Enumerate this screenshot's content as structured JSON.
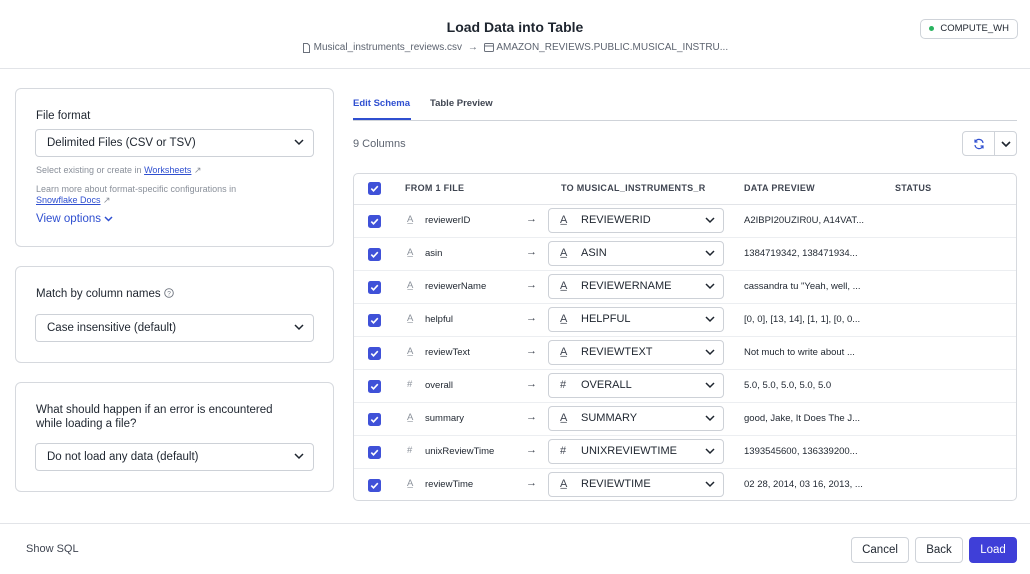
{
  "header": {
    "title": "Load Data into Table",
    "source_file": "Musical_instruments_reviews.csv",
    "target_table": "AMAZON_REVIEWS.PUBLIC.MUSICAL_INSTRU...",
    "warehouse": "COMPUTE_WH",
    "warehouse_status_color": "#29b35f"
  },
  "file_format": {
    "label": "File format",
    "value": "Delimited Files (CSV or TSV)",
    "hint_prefix": "Select existing or create in",
    "hint_link": "Worksheets",
    "learn_more": "Learn more about format-specific configurations in",
    "docs_link": "Snowflake Docs",
    "view_options": "View options"
  },
  "match": {
    "label": "Match by column names",
    "value": "Case insensitive (default)"
  },
  "error": {
    "label_line1": "What should happen if an error is encountered",
    "label_line2": "while loading a file?",
    "value": "Do not load any data (default)"
  },
  "tabs": [
    "Edit Schema",
    "Table Preview"
  ],
  "column_count": "9 Columns",
  "table": {
    "headers": [
      "FROM 1 FILE",
      "TO MUSICAL_INSTRUMENTS_R",
      "DATA PREVIEW",
      "STATUS"
    ],
    "rows": [
      {
        "src": "reviewerID",
        "src_type": "text-icon",
        "tgt": "REVIEWERID",
        "tgt_type": "text-icon",
        "preview": "A2IBPI20UZIR0U, A14VAT..."
      },
      {
        "src": "asin",
        "src_type": "text-icon",
        "tgt": "ASIN",
        "tgt_type": "text-icon",
        "preview": "1384719342, 138471934..."
      },
      {
        "src": "reviewerName",
        "src_type": "text-icon",
        "tgt": "REVIEWERNAME",
        "tgt_type": "text-icon",
        "preview": "cassandra tu \"Yeah, well, ..."
      },
      {
        "src": "helpful",
        "src_type": "text-icon",
        "tgt": "HELPFUL",
        "tgt_type": "text-icon",
        "preview": "[0, 0], [13, 14], [1, 1], [0, 0..."
      },
      {
        "src": "reviewText",
        "src_type": "text-icon",
        "tgt": "REVIEWTEXT",
        "tgt_type": "text-icon",
        "preview": "Not much to write about ..."
      },
      {
        "src": "overall",
        "src_type": "number-icon",
        "tgt": "OVERALL",
        "tgt_type": "number-icon",
        "preview": "5.0, 5.0, 5.0, 5.0, 5.0"
      },
      {
        "src": "summary",
        "src_type": "text-icon",
        "tgt": "SUMMARY",
        "tgt_type": "text-icon",
        "preview": "good, Jake, It Does The J..."
      },
      {
        "src": "unixReviewTime",
        "src_type": "number-icon",
        "tgt": "UNIXREVIEWTIME",
        "tgt_type": "number-icon",
        "preview": "1393545600, 136339200..."
      },
      {
        "src": "reviewTime",
        "src_type": "text-icon",
        "tgt": "REVIEWTIME",
        "tgt_type": "text-icon",
        "preview": "02 28, 2014, 03 16, 2013, ..."
      }
    ]
  },
  "footer": {
    "show_sql": "Show SQL",
    "cancel": "Cancel",
    "back": "Back",
    "load": "Load"
  },
  "colors": {
    "accent": "#3f3fd8",
    "link": "#2f4fd0"
  }
}
